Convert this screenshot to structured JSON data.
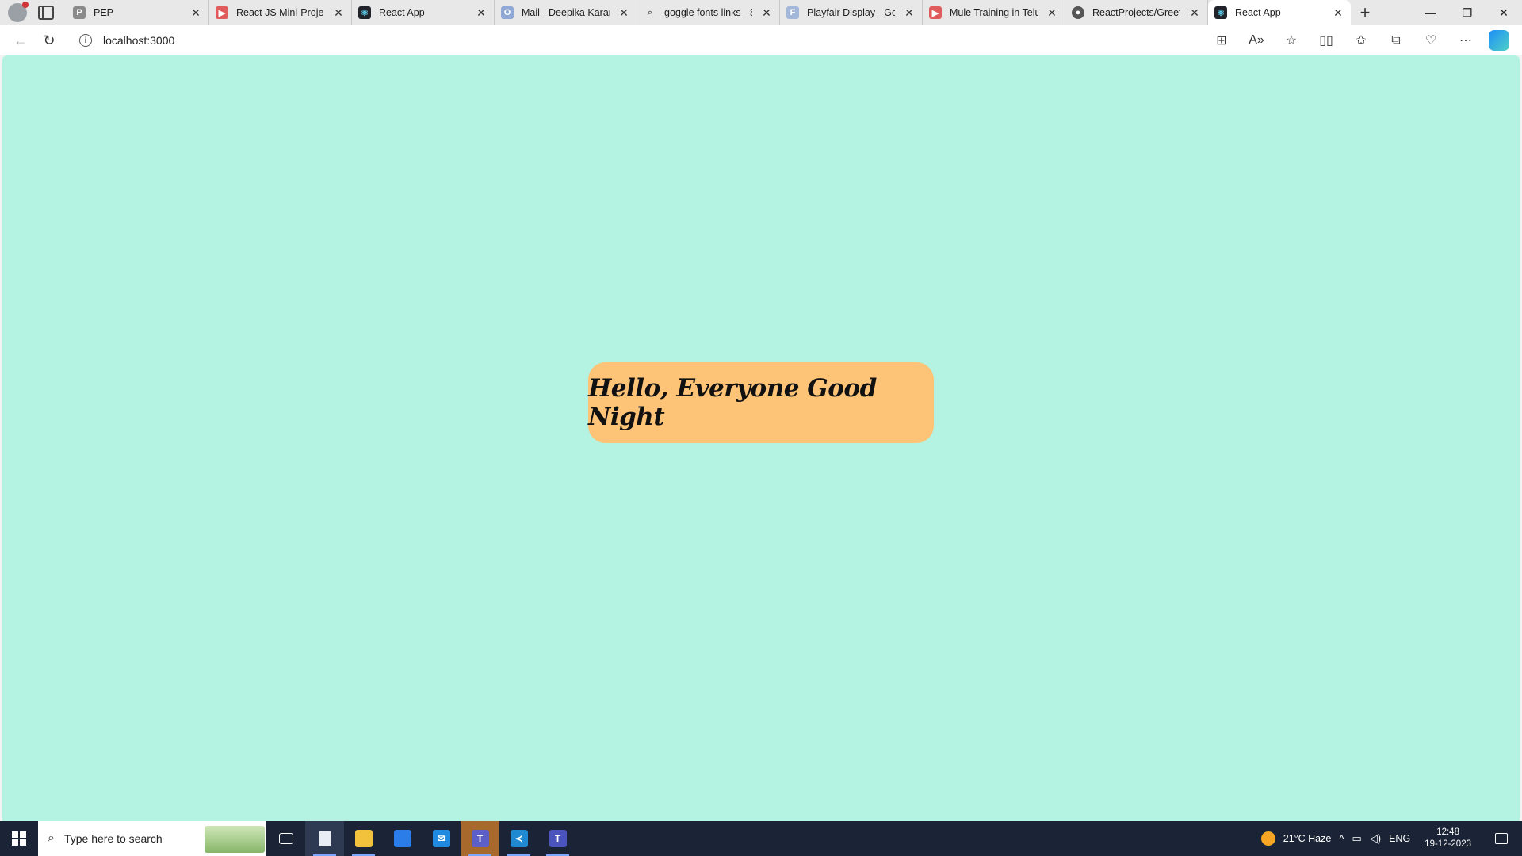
{
  "browser": {
    "tabs": [
      {
        "title": "PEP",
        "favicon": "pep-icon",
        "active": false
      },
      {
        "title": "React JS Mini-Project",
        "favicon": "youtube-icon",
        "active": false
      },
      {
        "title": "React App",
        "favicon": "react-icon",
        "active": false
      },
      {
        "title": "Mail - Deepika Karana",
        "favicon": "outlook-icon",
        "active": false
      },
      {
        "title": "goggle fonts links - S",
        "favicon": "search-icon",
        "active": false
      },
      {
        "title": "Playfair Display - Goo",
        "favicon": "google-fonts-icon",
        "active": false
      },
      {
        "title": "Mule Training in Telug",
        "favicon": "youtube-icon",
        "active": false
      },
      {
        "title": "ReactProjects/Greetin",
        "favicon": "github-icon",
        "active": false
      },
      {
        "title": "React App",
        "favicon": "react-icon",
        "active": true
      }
    ],
    "address": {
      "url": "localhost:3000"
    }
  },
  "page": {
    "greeting": "Hello, Everyone Good Night",
    "background_color": "#b4f2e1",
    "card_color": "#fdc377"
  },
  "taskbar": {
    "search_placeholder": "Type here to search",
    "apps": [
      "task-view-icon",
      "notepad-icon",
      "file-explorer-icon",
      "microsoft-store-icon",
      "mail-icon",
      "teams-icon",
      "vscode-icon",
      "teams-new-icon"
    ],
    "weather": "21°C  Haze",
    "language": "ENG",
    "time": "12:48",
    "date": "19-12-2023"
  }
}
